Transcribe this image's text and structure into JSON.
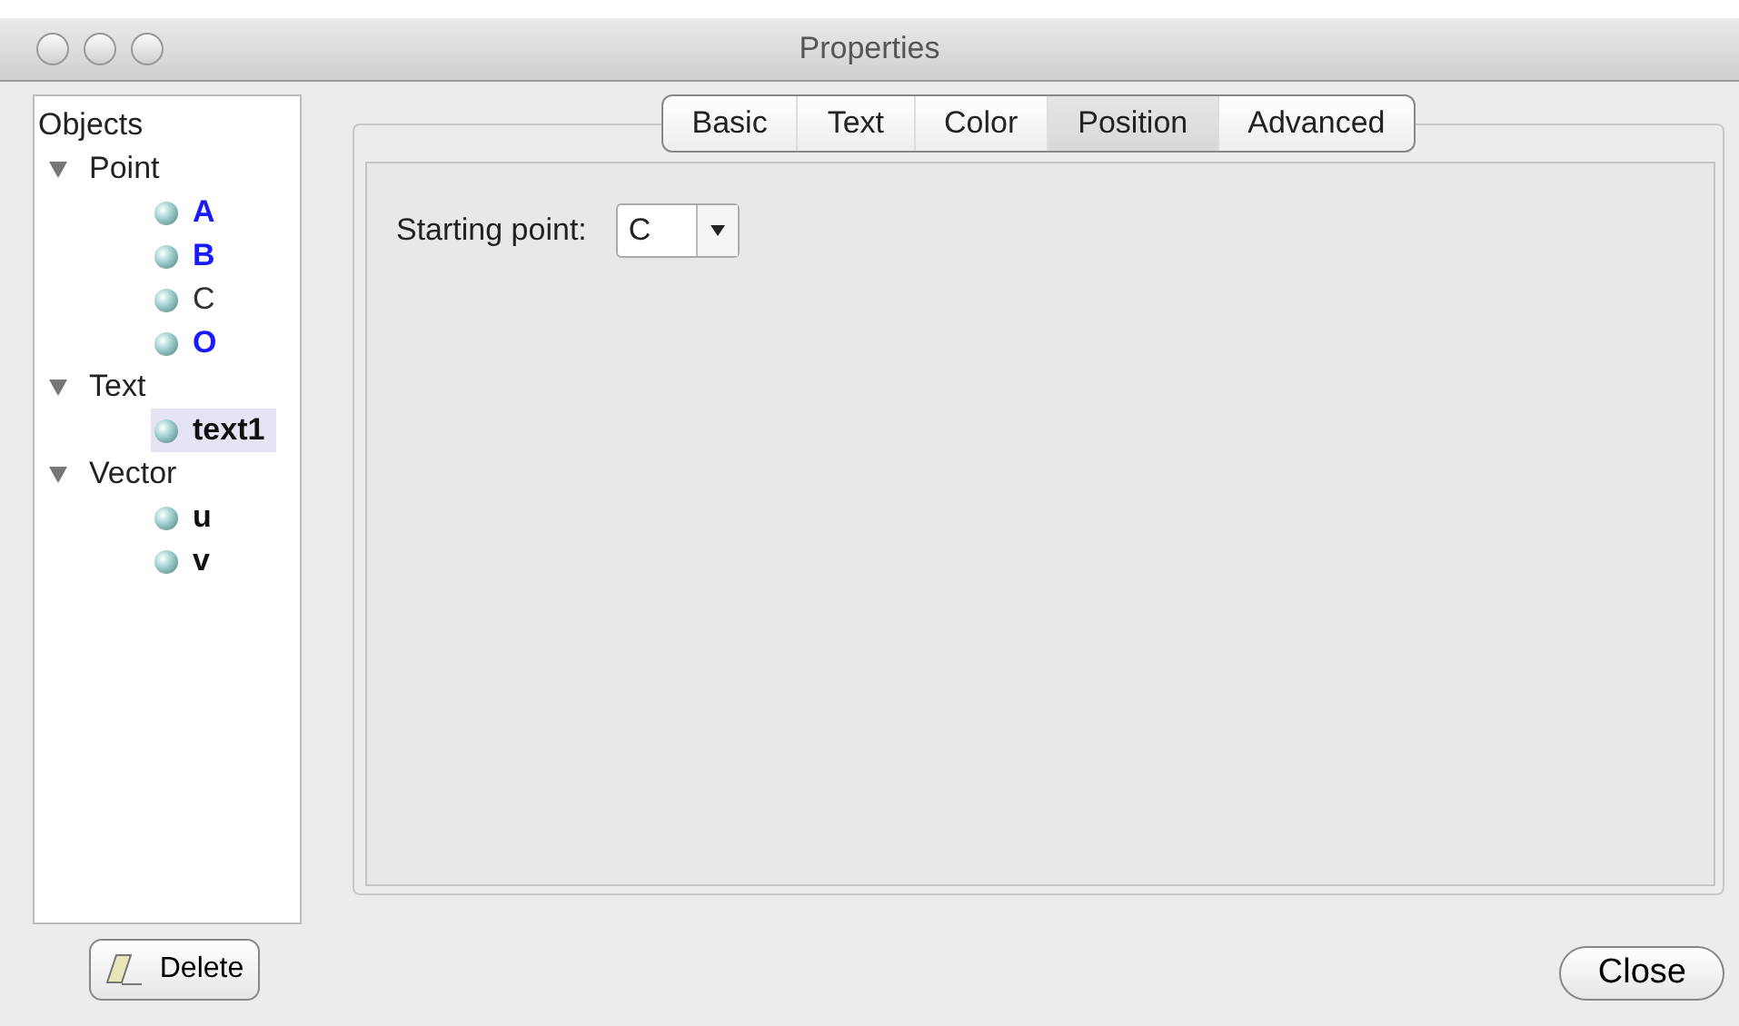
{
  "window": {
    "title": "Properties"
  },
  "tree": {
    "label": "Objects",
    "groups": [
      {
        "label": "Point",
        "expanded": true,
        "children": [
          {
            "label": "A",
            "color": "#1a1aff",
            "bold": true,
            "selected": false
          },
          {
            "label": "B",
            "color": "#1a1aff",
            "bold": true,
            "selected": false
          },
          {
            "label": "C",
            "color": "#333333",
            "bold": false,
            "selected": false
          },
          {
            "label": "O",
            "color": "#1a1aff",
            "bold": true,
            "selected": false
          }
        ]
      },
      {
        "label": "Text",
        "expanded": true,
        "children": [
          {
            "label": "text1",
            "color": "#111111",
            "bold": true,
            "selected": true
          }
        ]
      },
      {
        "label": "Vector",
        "expanded": true,
        "children": [
          {
            "label": "u",
            "color": "#111111",
            "bold": true,
            "selected": false
          },
          {
            "label": "v",
            "color": "#111111",
            "bold": true,
            "selected": false
          }
        ]
      }
    ]
  },
  "tabs": [
    {
      "label": "Basic",
      "selected": false
    },
    {
      "label": "Text",
      "selected": false
    },
    {
      "label": "Color",
      "selected": false
    },
    {
      "label": "Position",
      "selected": true
    },
    {
      "label": "Advanced",
      "selected": false
    }
  ],
  "fields": [
    {
      "label": "Starting point:",
      "value": "C"
    }
  ],
  "buttons": {
    "delete": "Delete",
    "close": "Close"
  }
}
